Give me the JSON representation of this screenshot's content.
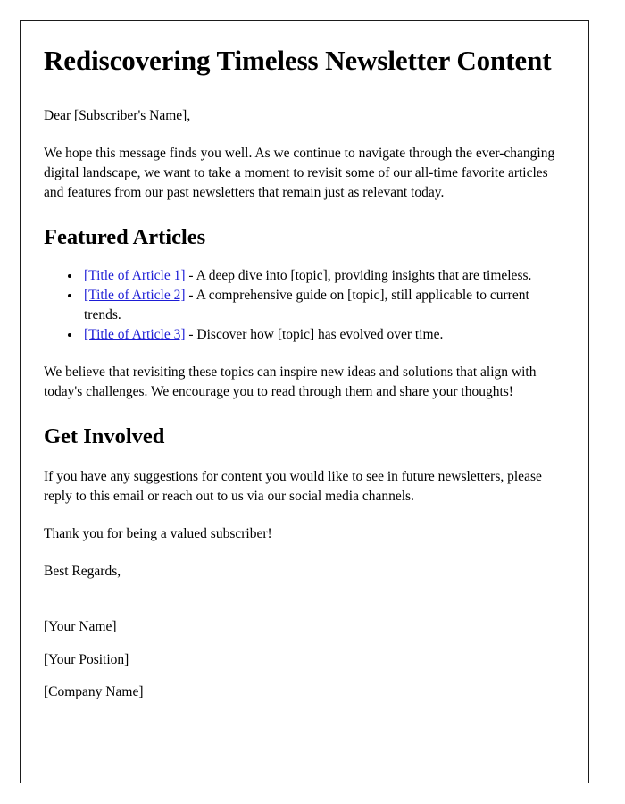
{
  "document": {
    "title": "Rediscovering Timeless Newsletter Content",
    "salutation": "Dear [Subscriber's Name],",
    "intro_paragraph": "We hope this message finds you well. As we continue to navigate through the ever-changing digital landscape, we want to take a moment to revisit some of our all-time favorite articles and features from our past newsletters that remain just as relevant today.",
    "featured_section": {
      "heading": "Featured Articles",
      "items": [
        {
          "link_text": "[Title of Article 1]",
          "description": " - A deep dive into [topic], providing insights that are timeless."
        },
        {
          "link_text": "[Title of Article 2]",
          "description": " - A comprehensive guide on [topic], still applicable to current trends."
        },
        {
          "link_text": "[Title of Article 3]",
          "description": " - Discover how [topic] has evolved over time."
        }
      ],
      "closing_paragraph": "We believe that revisiting these topics can inspire new ideas and solutions that align with today's challenges. We encourage you to read through them and share your thoughts!"
    },
    "get_involved_section": {
      "heading": "Get Involved",
      "paragraph": "If you have any suggestions for content you would like to see in future newsletters, please reply to this email or reach out to us via our social media channels.",
      "thanks": "Thank you for being a valued subscriber!"
    },
    "closing": {
      "sign_off": "Best Regards,",
      "name": "[Your Name]",
      "position": "[Your Position]",
      "company": "[Company Name]"
    }
  },
  "colors": {
    "link": "#1d1dd6",
    "text": "#000000",
    "page_border": "#1b1b1b",
    "background": "#ffffff"
  }
}
